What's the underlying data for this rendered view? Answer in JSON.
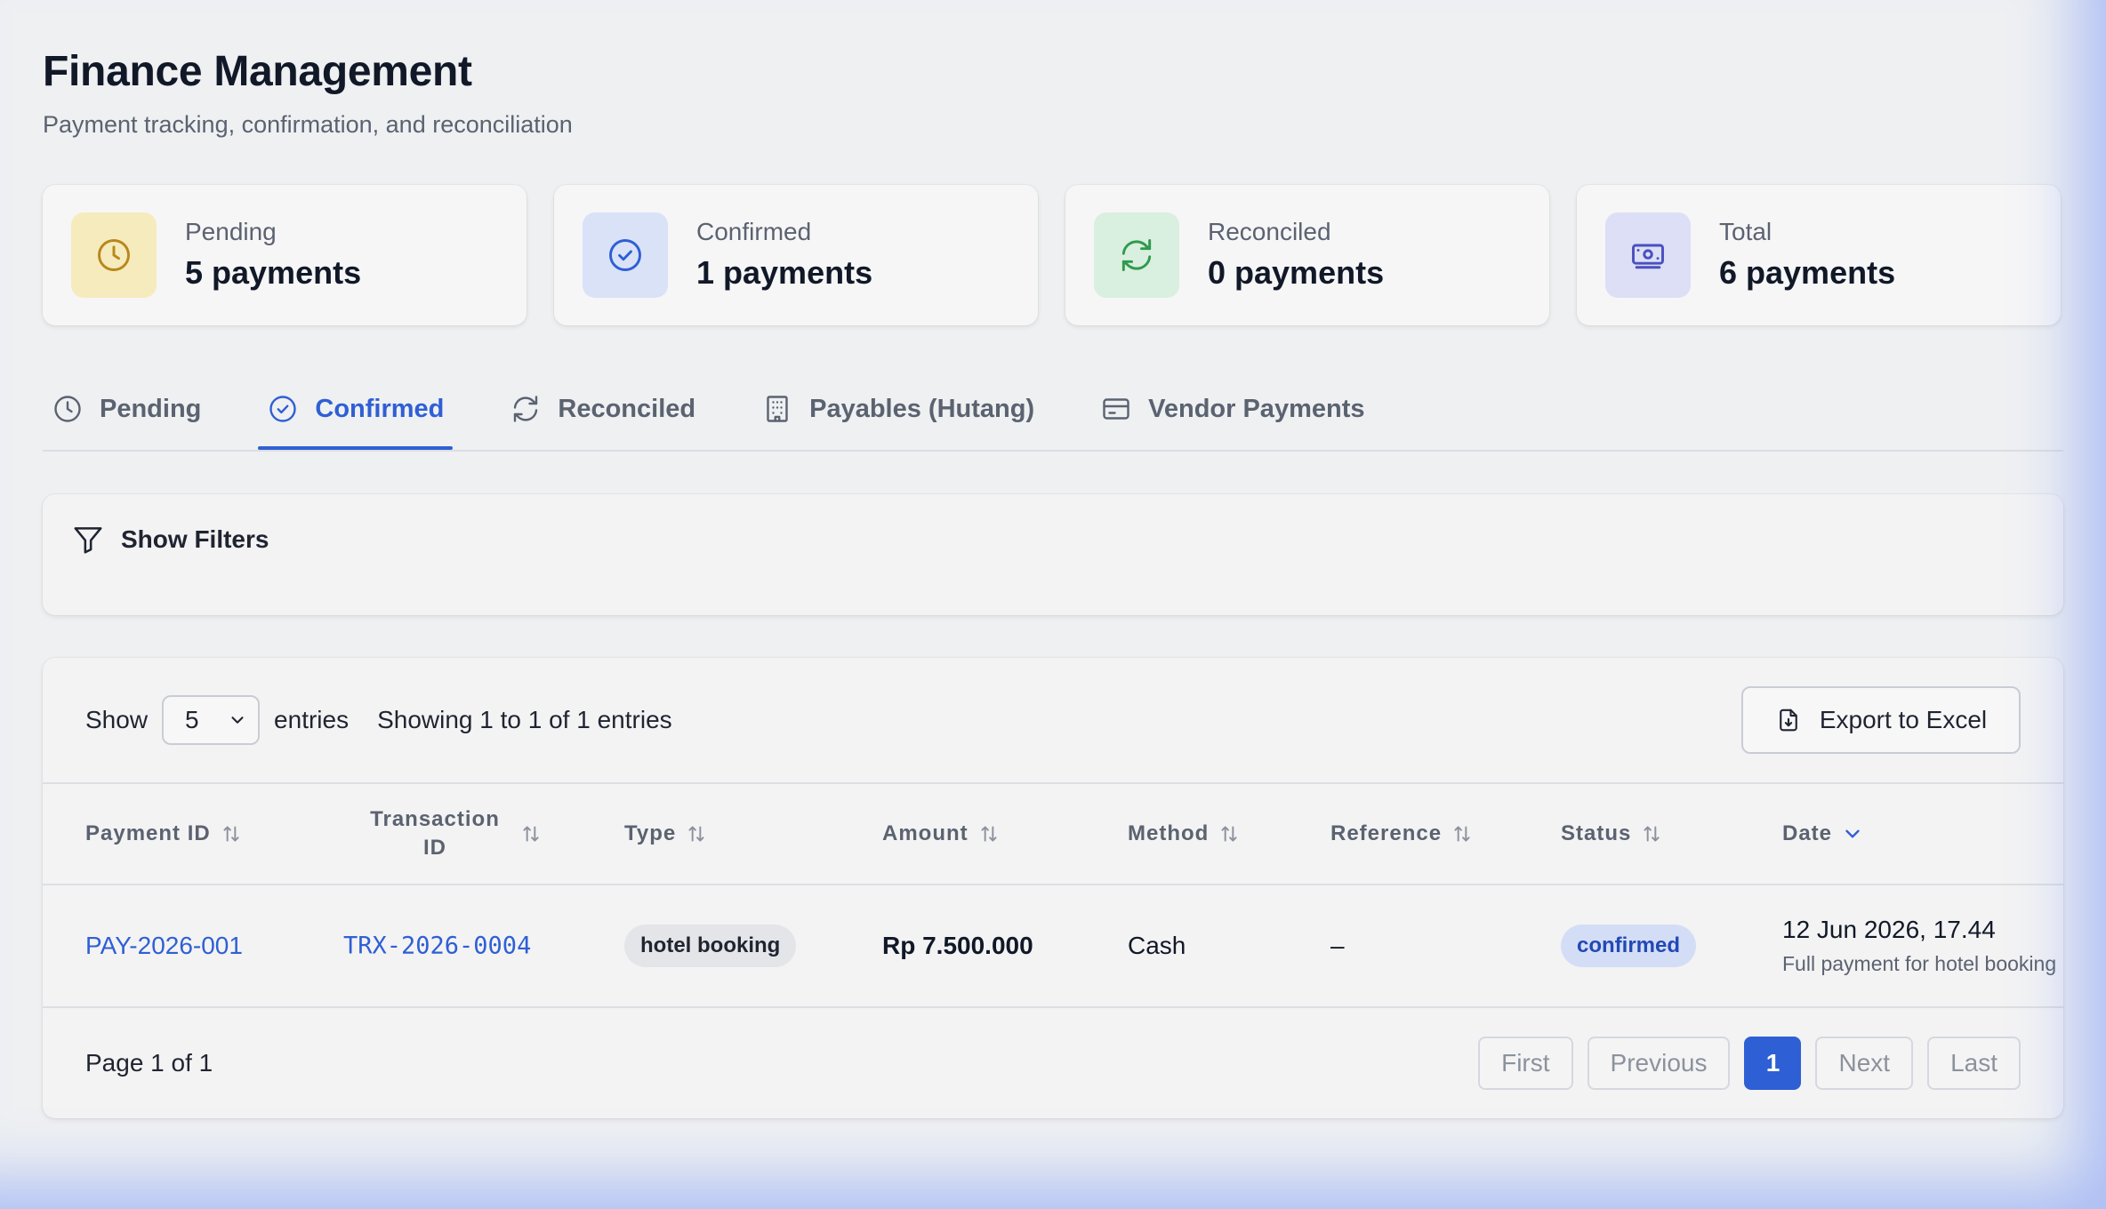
{
  "header": {
    "title": "Finance Management",
    "subtitle": "Payment tracking, confirmation, and reconciliation"
  },
  "stats": [
    {
      "label": "Pending",
      "value": "5 payments",
      "icon": "clock-icon",
      "bg": "#f6ebbd",
      "color": "#b9871a"
    },
    {
      "label": "Confirmed",
      "value": "1 payments",
      "icon": "check-circle-icon",
      "bg": "#d9e2f7",
      "color": "#2f5fd4"
    },
    {
      "label": "Reconciled",
      "value": "0 payments",
      "icon": "refresh-icon",
      "bg": "#d9efdf",
      "color": "#2f9a4e"
    },
    {
      "label": "Total",
      "value": "6 payments",
      "icon": "banknote-icon",
      "bg": "#dcdff5",
      "color": "#4a4fc0"
    }
  ],
  "tabs": [
    {
      "label": "Pending",
      "icon": "clock-icon",
      "active": false
    },
    {
      "label": "Confirmed",
      "icon": "check-circle-icon",
      "active": true
    },
    {
      "label": "Reconciled",
      "icon": "refresh-icon",
      "active": false
    },
    {
      "label": "Payables (Hutang)",
      "icon": "building-icon",
      "active": false
    },
    {
      "label": "Vendor Payments",
      "icon": "credit-card-icon",
      "active": false
    }
  ],
  "filters": {
    "label": "Show Filters"
  },
  "toolbar": {
    "show_label": "Show",
    "page_size": "5",
    "entries_label": "entries",
    "showing_text": "Showing 1 to 1 of 1 entries",
    "export_label": "Export to Excel"
  },
  "table": {
    "columns": [
      {
        "label": "Payment ID",
        "sort": "both"
      },
      {
        "label": "Transaction ID",
        "sort": "both"
      },
      {
        "label": "Type",
        "sort": "both"
      },
      {
        "label": "Amount",
        "sort": "both"
      },
      {
        "label": "Method",
        "sort": "both"
      },
      {
        "label": "Reference",
        "sort": "both"
      },
      {
        "label": "Status",
        "sort": "both"
      },
      {
        "label": "Date",
        "sort": "desc"
      }
    ],
    "rows": [
      {
        "payment_id": "PAY-2026-001",
        "transaction_id": "TRX-2026-0004",
        "type": "hotel booking",
        "amount": "Rp 7.500.000",
        "method": "Cash",
        "reference": "–",
        "status": "confirmed",
        "date": "12 Jun 2026, 17.44",
        "note": "Full payment for hotel booking"
      }
    ]
  },
  "pagination": {
    "page_text": "Page 1 of 1",
    "first": "First",
    "previous": "Previous",
    "current": "1",
    "next": "Next",
    "last": "Last"
  }
}
